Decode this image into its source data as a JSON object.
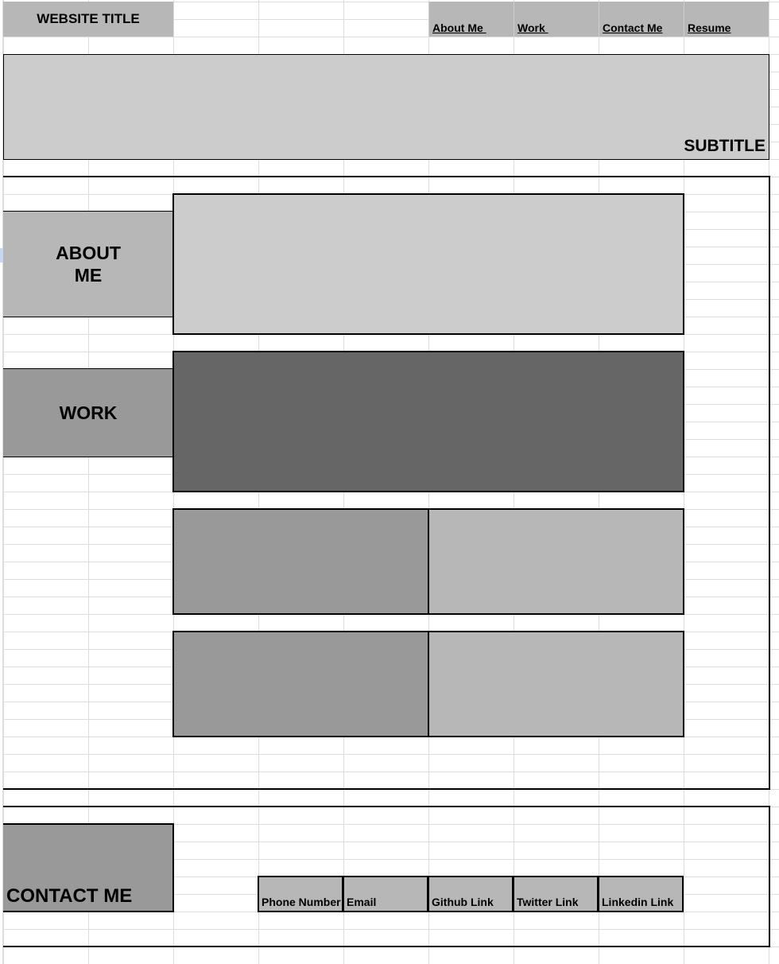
{
  "header": {
    "site_title": "WEBSITE TITLE",
    "nav": [
      "About Me ",
      "Work ",
      "Contact Me",
      "Resume"
    ]
  },
  "hero": {
    "subtitle": "SUBTITLE"
  },
  "sections": {
    "about_label": "ABOUT\nME",
    "work_label": "WORK"
  },
  "contact": {
    "label": "CONTACT ME",
    "links": [
      "Phone Number",
      "Email",
      "Github Link",
      "Twitter Link",
      "Linkedin Link"
    ]
  },
  "colors": {
    "light_gray": "#cccccc",
    "mid_gray": "#b7b7b7",
    "gray": "#999999",
    "dark_gray": "#666666",
    "grid_line": "#dcdcdc"
  }
}
